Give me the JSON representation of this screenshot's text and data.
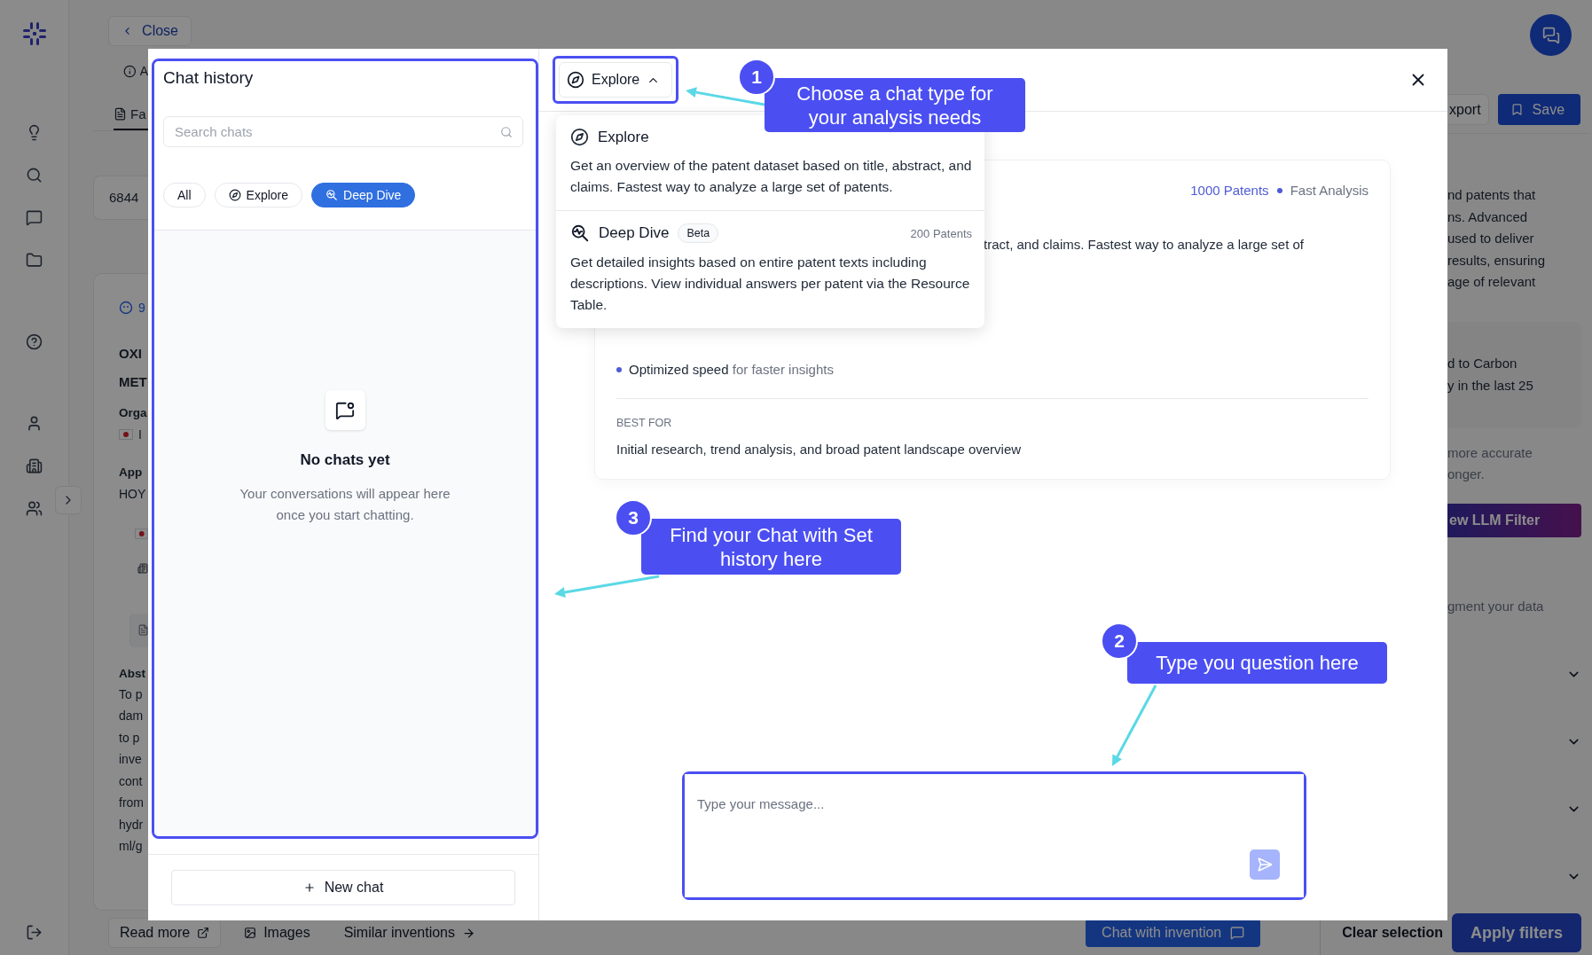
{
  "background": {
    "close_button": "Close",
    "info_text": "A",
    "tab": "Fa",
    "count": "6844",
    "card_badge": "9",
    "title_lines": [
      "OXI",
      "MET"
    ],
    "organization_label": "Orga",
    "organization_value": "I",
    "applicant_label": "App",
    "applicant_value": "HOY",
    "abstract_label": "Abst",
    "abstract_lines": [
      "To p",
      "dam",
      "to p",
      "inve",
      "cont",
      "from",
      "hydr",
      "ml/g"
    ],
    "export_button": "xport",
    "save_button": "Save",
    "description_lines": [
      "nd patents that",
      "ns. Advanced",
      "used to deliver",
      "results, ensuring",
      "age of relevant"
    ],
    "note_lines": [
      "d to Carbon",
      "y in the last 25"
    ],
    "accuracy_lines": [
      "more accurate",
      "onger."
    ],
    "llm_button": "ew LLM Filter",
    "segment_text": "gment your data",
    "bottom_links": [
      {
        "label": "Read more",
        "kind": "external"
      },
      {
        "label": "Images",
        "kind": "images"
      },
      {
        "label": "Similar inventions",
        "kind": "arrow"
      }
    ],
    "chat_with_invention": "Chat with invention",
    "clear_selection": "Clear selection",
    "apply_filters": "Apply filters"
  },
  "chat_history": {
    "title": "Chat history",
    "search": {
      "placeholder": "Search chats"
    },
    "filters": [
      {
        "label": "All",
        "kind": "all",
        "selected": false
      },
      {
        "label": "Explore",
        "kind": "explore",
        "selected": false
      },
      {
        "label": "Deep Dive",
        "kind": "deep",
        "selected": true
      }
    ],
    "empty_title": "No chats yet",
    "empty_text": "Your conversations will appear here once you start chatting.",
    "new_chat": "New chat"
  },
  "chat_type": {
    "label": "Explore",
    "expanded": true
  },
  "menu": [
    {
      "kind": "explore",
      "title": "Explore",
      "description": "Get an overview of the patent dataset based on title, abstract, and claims. Fastest way to analyze a large set of patents."
    },
    {
      "kind": "deep",
      "title": "Deep Dive",
      "badge": "Beta",
      "count": "200 Patents",
      "description": "Get detailed insights based on entire patent texts including descriptions. View individual answers per patent via the Resource Table."
    }
  ],
  "mode_card": {
    "patents": "1000 Patents",
    "speed": "Fast Analysis",
    "description_fragment": "tract, and claims. Fastest way to analyze a large set of",
    "features": [
      {
        "label": "Optimized speed",
        "detail": "for faster insights"
      }
    ],
    "best_for_label": "BEST FOR",
    "best_for": "Initial research, trend analysis, and broad patent landscape overview"
  },
  "message": {
    "placeholder": "Type your message..."
  },
  "callouts": [
    {
      "number": "1",
      "text": "Choose a chat type for your analysis needs"
    },
    {
      "number": "3",
      "text": "Find your Chat with Set history here"
    },
    {
      "number": "2",
      "text": "Type you question here"
    }
  ]
}
